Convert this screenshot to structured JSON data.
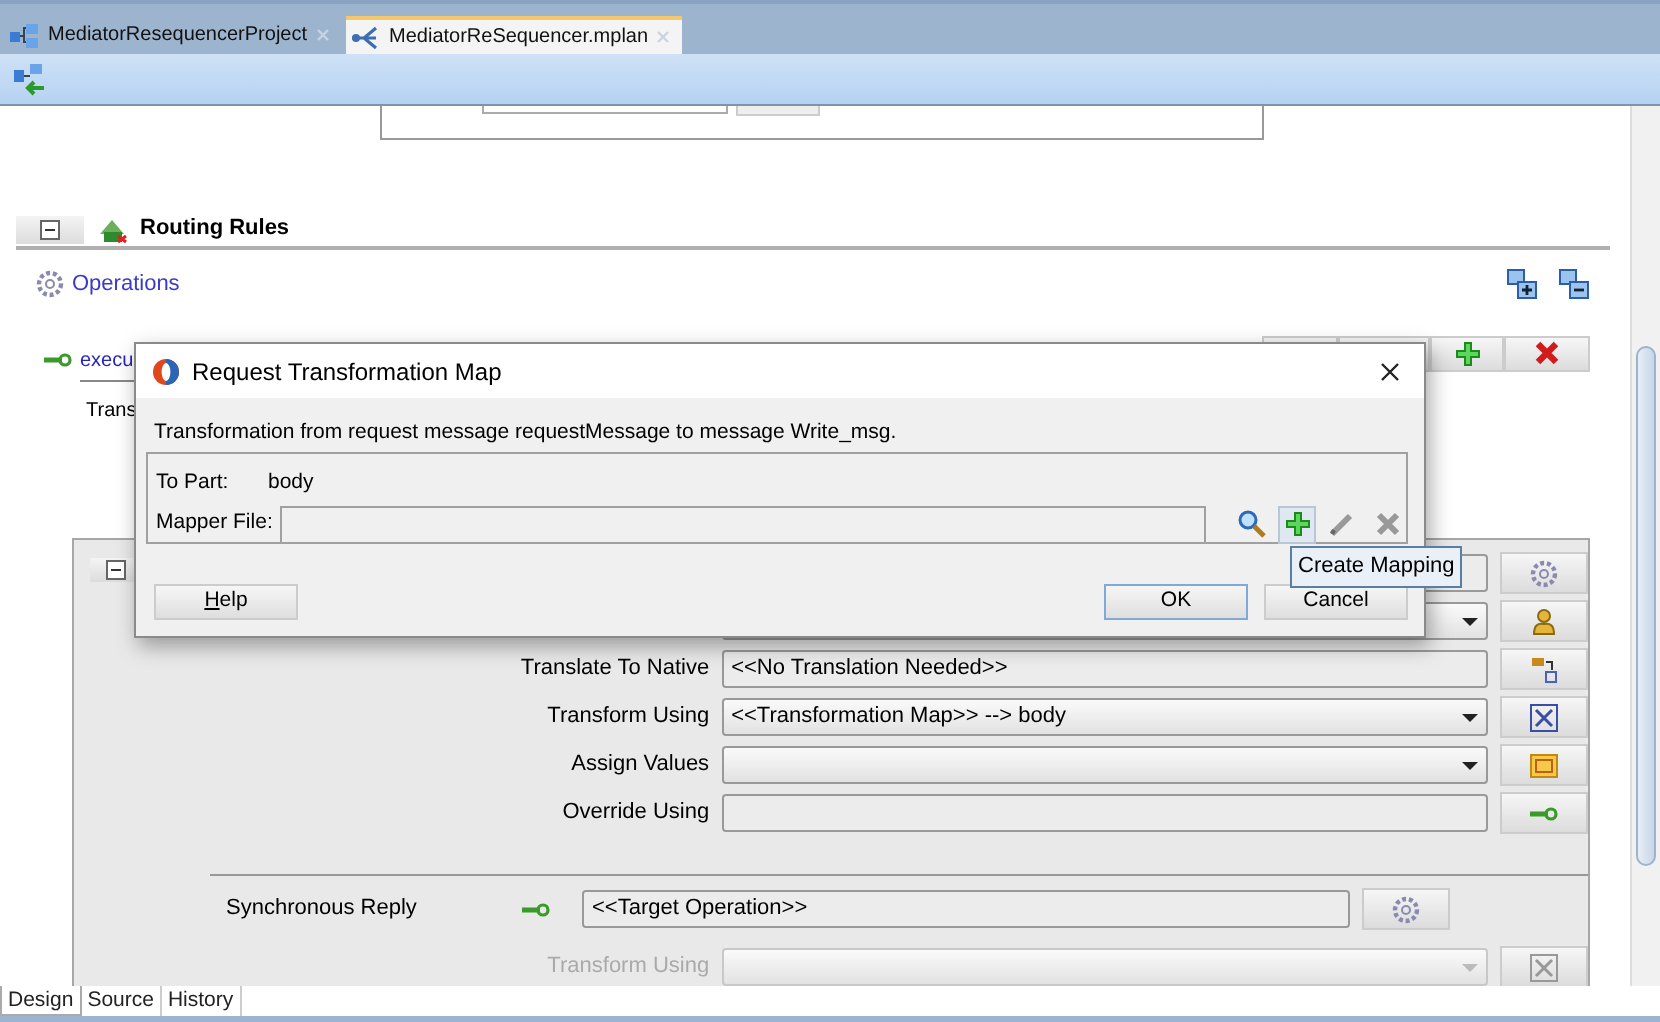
{
  "tabs": [
    {
      "label": "MediatorResequencerProject",
      "selected": false
    },
    {
      "label": "MediatorReSequencer.mplan",
      "selected": true
    }
  ],
  "routing_rules": {
    "title": "Routing Rules",
    "expanded": true,
    "operations_link": "Operations",
    "operation": {
      "name": "execu",
      "transform_label": "Trans"
    },
    "panel": {
      "expanded": true,
      "rows": [
        {
          "kind": "text",
          "disabled": false
        },
        {
          "kind": "select",
          "disabled": false
        },
        {
          "kind": "text",
          "label": "Translate To Native",
          "value": "<<No Translation Needed>>",
          "disabled": false
        },
        {
          "kind": "select",
          "label": "Transform Using",
          "value": "<<Transformation Map>> --> body",
          "disabled": false
        },
        {
          "kind": "select",
          "label": "Assign Values",
          "disabled": false
        },
        {
          "kind": "text",
          "label": "Override Using",
          "disabled": false
        }
      ],
      "reply": {
        "label": "Synchronous Reply",
        "value": "<<Target Operation>>",
        "rows": [
          {
            "kind": "select",
            "label": "Transform Using",
            "disabled": true
          }
        ]
      }
    }
  },
  "dialog": {
    "title": "Request Transformation Map",
    "message": "Transformation from request message requestMessage to message Write_msg.",
    "to_part_label": "To Part:",
    "to_part": "body",
    "mapper_label": "Mapper File:",
    "tools": [
      {
        "hovered": false
      },
      {
        "hovered": true
      },
      {
        "hovered": false
      },
      {
        "hovered": false
      }
    ],
    "tooltip": "Create Mapping",
    "buttons": [
      {
        "label": "Help",
        "mnemonic": true,
        "default": false
      },
      {
        "label": "OK",
        "mnemonic": false,
        "default": true
      },
      {
        "label": "Cancel",
        "mnemonic": false,
        "default": false
      }
    ]
  },
  "bottom_tabs": [
    {
      "label": "Design",
      "selected": true
    },
    {
      "label": "Source",
      "selected": false
    },
    {
      "label": "History",
      "selected": false
    }
  ]
}
